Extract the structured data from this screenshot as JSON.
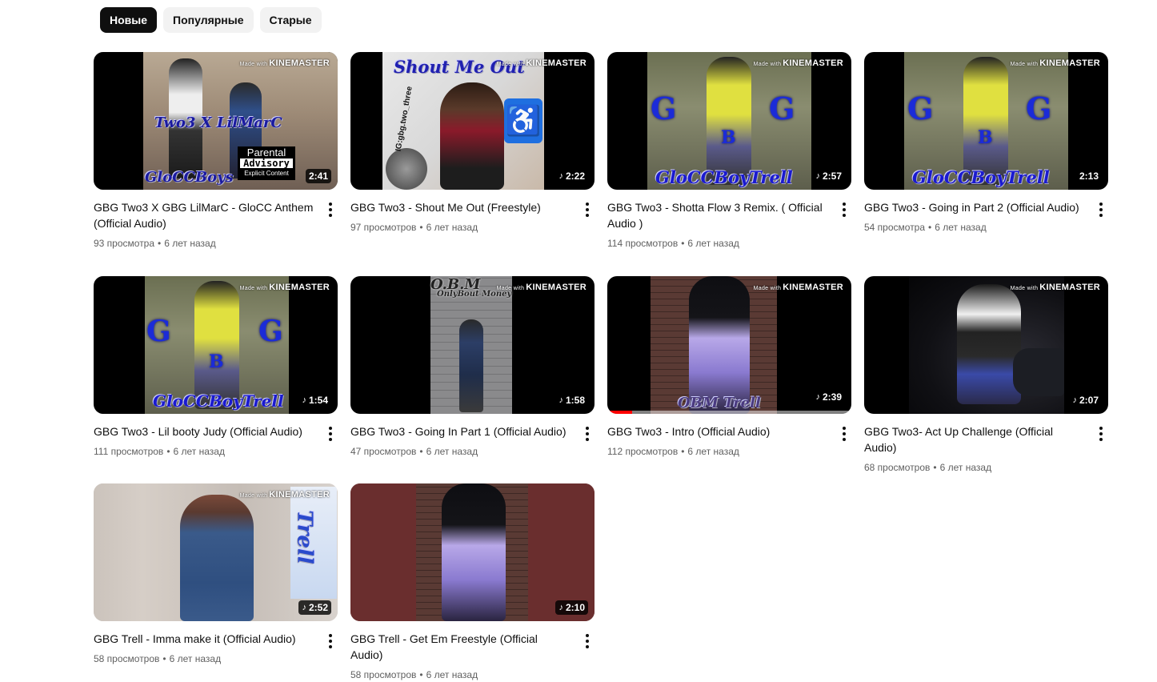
{
  "chips": [
    "Новые",
    "Популярные",
    "Старые"
  ],
  "watermark": {
    "made_with": "Made with",
    "brand": "KINEMASTER"
  },
  "videos": [
    {
      "title": "GBG Two3 X GBG LilMarC - GloCC Anthem (Official Audio)",
      "views": "93 просмотра",
      "age": "6 лет назад",
      "duration": "2:41",
      "music_icon": false,
      "overlay": {
        "top": "Two3 X LilMarC",
        "bottom": "GloCCBoys",
        "advisory_1": "Parental",
        "advisory_2": "Advisory",
        "advisory_3": "Explicit Content"
      }
    },
    {
      "title": "GBG Two3 - Shout Me Out (Freestyle)",
      "views": "97 просмотров",
      "age": "6 лет назад",
      "duration": "2:22",
      "music_icon": true,
      "overlay": {
        "top": "Shout Me Out",
        "side": "IG:gbg.two_three",
        "accessibility": "♿"
      }
    },
    {
      "title": "GBG Two3 - Shotta Flow 3 Remix. ( Official Audio )",
      "views": "114 просмотров",
      "age": "6 лет назад",
      "duration": "2:57",
      "music_icon": true,
      "overlay": {
        "bottom": "GloCCBoyTrell",
        "letters": [
          "G",
          "B",
          "G"
        ]
      }
    },
    {
      "title": "GBG Two3 - Going in Part 2 (Official Audio)",
      "views": "54 просмотра",
      "age": "6 лет назад",
      "duration": "2:13",
      "music_icon": false,
      "overlay": {
        "bottom": "GloCCBoyTrell",
        "letters": [
          "G",
          "B",
          "G"
        ]
      }
    },
    {
      "title": "GBG Two3 - Lil booty Judy (Official Audio)",
      "views": "111 просмотров",
      "age": "6 лет назад",
      "duration": "1:54",
      "music_icon": true,
      "overlay": {
        "bottom": "GloCCBoyTrell",
        "letters": [
          "G",
          "B",
          "G"
        ]
      }
    },
    {
      "title": "GBG Two3 - Going In Part 1 (Official Audio)",
      "views": "47 просмотров",
      "age": "6 лет назад",
      "duration": "1:58",
      "music_icon": true,
      "overlay": {
        "top": "O.B.M",
        "sub": "OnlyBout Money"
      }
    },
    {
      "title": "GBG Two3 - Intro (Official Audio)",
      "views": "112 просмотров",
      "age": "6 лет назад",
      "duration": "2:39",
      "music_icon": true,
      "progress": 0.1,
      "overlay": {
        "bottom": "OBM Trell"
      }
    },
    {
      "title": "GBG Two3- Act Up Challenge (Official Audio)",
      "views": "68 просмотров",
      "age": "6 лет назад",
      "duration": "2:07",
      "music_icon": true,
      "overlay": {}
    },
    {
      "title": "GBG Trell - Imma make it (Official Audio)",
      "views": "58 просмотров",
      "age": "6 лет назад",
      "duration": "2:52",
      "music_icon": true,
      "overlay": {
        "side": "Trell"
      }
    },
    {
      "title": "GBG Trell - Get Em Freestyle (Official Audio)",
      "views": "58 просмотров",
      "age": "6 лет назад",
      "duration": "2:10",
      "music_icon": true,
      "overlay": {}
    }
  ]
}
